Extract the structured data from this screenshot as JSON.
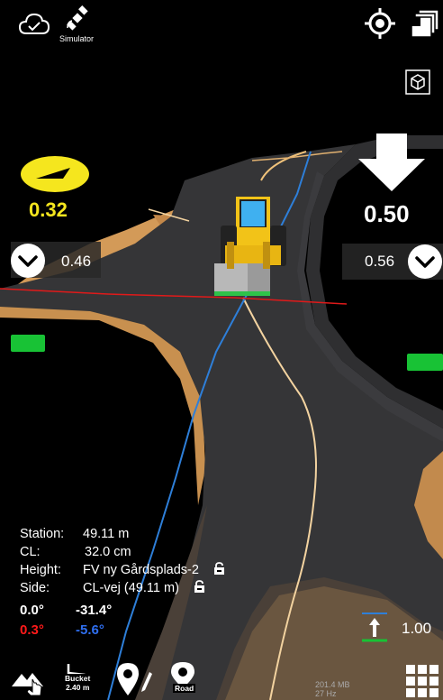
{
  "header": {
    "simulator_label": "Simulator"
  },
  "left_indicator": {
    "value": "0.32",
    "color": "#f5e61e",
    "dropdown_value": "0.46"
  },
  "right_indicator": {
    "value": "0.50",
    "dropdown_value": "0.56"
  },
  "status_colors": {
    "ok_green": "#18c235",
    "error_red": "#ff1a1a"
  },
  "info": {
    "station_label": "Station:",
    "station_value": "49.11 m",
    "cl_label": "CL:",
    "cl_value": "32.0 cm",
    "height_label": "Height:",
    "height_value": "FV ny Gårdsplads-2",
    "side_label": "Side:",
    "side_value": "CL-vej (49.11 m)"
  },
  "angles": {
    "row1_left": "0.0°",
    "row1_right": "-31.4°",
    "row2_left": "0.3°",
    "row2_right": "-5.6°"
  },
  "scale": {
    "value": "1.00"
  },
  "bottom_bar": {
    "bucket_label": "Bucket",
    "bucket_size": "2.40 m",
    "road_label": "Road",
    "memory": "201.4 MB",
    "frequency": "27 Hz"
  },
  "icons": [
    "cloud-check-icon",
    "satellite-icon",
    "locate-target-icon",
    "layers-icon",
    "cube-view-icon",
    "wheel-loader-icon",
    "chevron-down-icon",
    "lock-icon",
    "up-arrow-icon",
    "terrain-touch-icon",
    "bucket-icon",
    "pin-edit-icon",
    "road-pin-icon",
    "grid-menu-icon"
  ]
}
